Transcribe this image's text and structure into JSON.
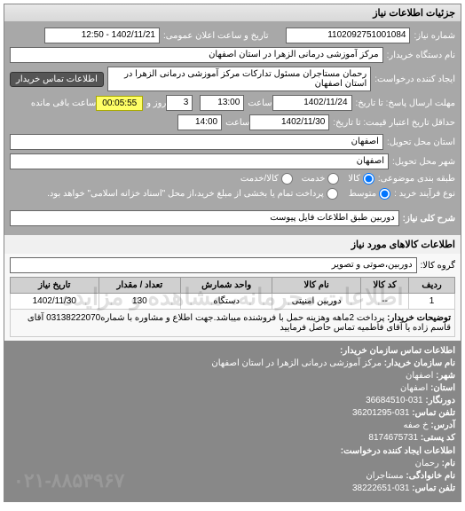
{
  "panel_title": "جزئیات اطلاعات نیاز",
  "form": {
    "req_no_lbl": "شماره نیاز:",
    "req_no": "1102092751001084",
    "pub_dt_lbl": "تاریخ و ساعت اعلان عمومی:",
    "pub_dt": "1402/11/21 - 12:50",
    "buyer_dev_lbl": "نام دستگاه خریدار:",
    "buyer_dev": "مرکز آموزشی درمانی الزهرا در استان اصفهان",
    "creator_lbl": "ایجاد کننده درخواست:",
    "creator": "رحمان مستاجران مسئول تدارکات مرکز آموزشی درمانی الزهرا در استان اصفهان",
    "buyer_contact_btn": "اطلاعات تماس خریدار",
    "resp_deadline_lbl": "مهلت ارسال پاسخ: تا تاریخ:",
    "resp_date": "1402/11/24",
    "resp_time_lbl": "ساعت",
    "resp_time": "13:00",
    "days_lbl": "3",
    "days_suffix": "روز و",
    "remain_time": "00:05:55",
    "remain_suffix": "ساعت باقی مانده",
    "valid_lbl": "حداقل تاریخ اعتبار قیمت: تا تاریخ:",
    "valid_date": "1402/11/30",
    "valid_time": "14:00",
    "prov_lbl": "استان محل تحویل:",
    "prov": "اصفهان",
    "city_lbl": "شهر محل تحویل:",
    "city": "اصفهان",
    "cat_lbl": "طبقه بندی موضوعی:",
    "cat_goods": "کالا",
    "cat_service": "خدمت",
    "cat_both": "کالا/خدمت",
    "proc_lbl": "نوع فرآیند خرید :",
    "proc_mid": "متوسط",
    "proc_note": "پرداخت تمام یا بخشی از مبلغ خرید،از محل \"اسناد خزانه اسلامی\" خواهد بود.",
    "summary_lbl": "شرح کلی نیاز:",
    "summary": "دوربین طبق اطلاعات فایل پیوست"
  },
  "goods": {
    "section": "اطلاعات کالاهای مورد نیاز",
    "group_lbl": "گروه کالا:",
    "group": "دوربین،صوتی و تصویر",
    "cols": {
      "idx": "ردیف",
      "code": "کد کالا",
      "name": "نام کالا",
      "unit": "واحد شمارش",
      "qty": "تعداد / مقدار",
      "date": "تاریخ نیاز"
    },
    "rows": [
      {
        "idx": "1",
        "code": "--",
        "name": "دوربین امنیتی",
        "unit": "دستگاه",
        "qty": "130",
        "date": "1402/11/30"
      }
    ],
    "desc_lbl": "توضیحات خریدار:",
    "desc": "پرداخت 2ماهه وهزینه حمل با فروشنده میباشد.جهت اطلاع و مشاوره با شماره03138222070 آقای قاسم زاده یا آقای فاطمیه تماس حاصل فرمایید",
    "watermark": "اطلاعات محرمانه، مشاهده و مزایده"
  },
  "contact": {
    "hdr": "اطلاعات تماس سازمان خریدار:",
    "org_lbl": "نام سازمان خریدار:",
    "org": "مرکز آموزشی درمانی الزهرا در استان اصفهان",
    "city_lbl": "شهر:",
    "city": "اصفهان",
    "prov_lbl": "استان:",
    "prov": "اصفهان",
    "fax_lbl": "دورنگار:",
    "fax": "031-36684510",
    "tel_lbl": "تلفن تماس:",
    "tel": "031-36201295",
    "addr_lbl": "آدرس:",
    "addr": "خ صفه",
    "zip_lbl": "کد پستی:",
    "zip": "8174675731",
    "creator_hdr": "اطلاعات ایجاد کننده درخواست:",
    "name_lbl": "نام:",
    "name": "رحمان",
    "lname_lbl": "نام خانوادگی:",
    "lname": "مستاجران",
    "ctel_lbl": "تلفن تماس:",
    "ctel": "031-38222651",
    "wmk": "۰۲۱-۸۸۵۳۹۶۷"
  }
}
